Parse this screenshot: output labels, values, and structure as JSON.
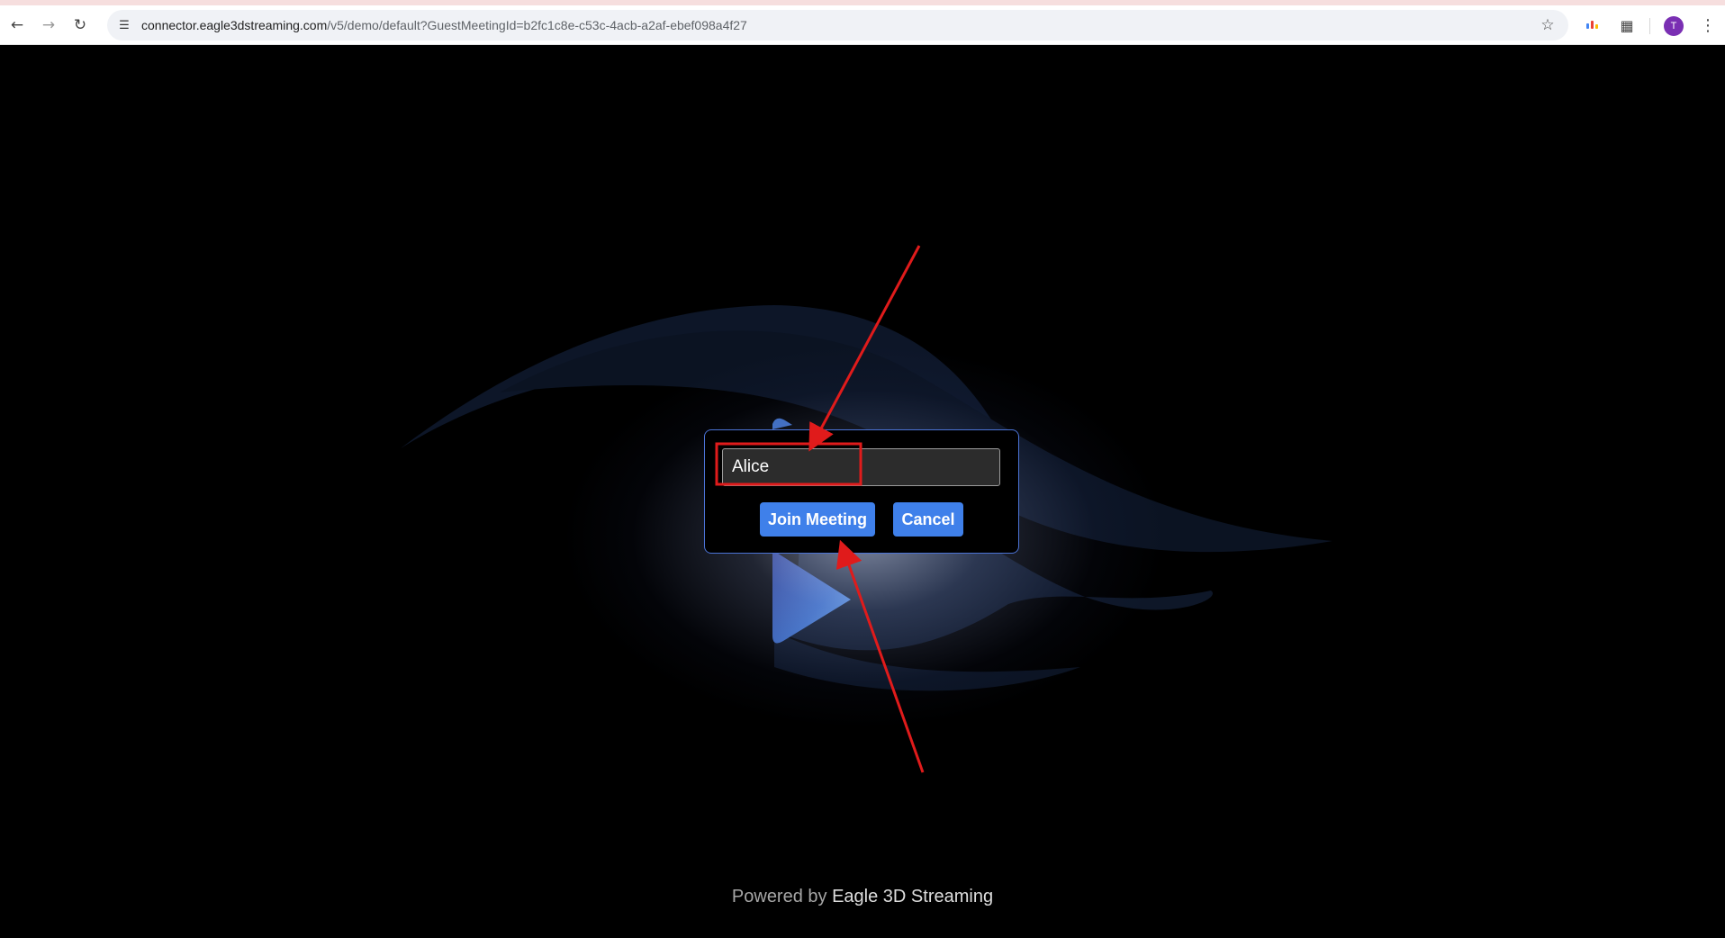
{
  "browser": {
    "url_host": "connector.eagle3dstreaming.com",
    "url_path": "/v5/demo/default?GuestMeetingId=b2fc1c8e-c53c-4acb-a2af-ebef098a4f27",
    "profile_initial": "T",
    "icons": {
      "back": "back-arrow-icon",
      "forward": "forward-arrow-icon",
      "reload": "reload-icon",
      "site_info": "tune-icon",
      "bookmark": "star-icon",
      "extensions": "puzzle-icon",
      "menu": "kebab-menu-icon"
    }
  },
  "dialog": {
    "name_value": "Alice",
    "join_label": "Join Meeting",
    "cancel_label": "Cancel"
  },
  "footer": {
    "prefix": "Powered by",
    "brand": "Eagle 3D Streaming"
  },
  "colors": {
    "accent_button": "#3f80ea",
    "dialog_border": "#4b73d6",
    "annotation_red": "#e01b1b",
    "profile_avatar": "#7a2fb3"
  }
}
